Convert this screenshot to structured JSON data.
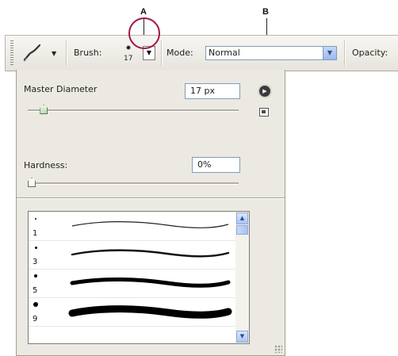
{
  "callouts": {
    "a": "A",
    "b": "B"
  },
  "toolbar": {
    "tool_icon": "brush-tool-icon",
    "brush_label": "Brush:",
    "brush_size": "17",
    "mode_label": "Mode:",
    "mode_value": "Normal",
    "opacity_label": "Opacity:"
  },
  "picker": {
    "master_diameter_label": "Master Diameter",
    "master_diameter_value": "17 px",
    "master_diameter_level": 0.06,
    "hardness_label": "Hardness:",
    "hardness_value": "0%",
    "hardness_level": 0.0,
    "brushes": [
      {
        "size": "1"
      },
      {
        "size": "3"
      },
      {
        "size": "5"
      },
      {
        "size": "9"
      }
    ]
  },
  "colors": {
    "callout_circle": "#a0144a",
    "panel": "#ebe9e1"
  }
}
